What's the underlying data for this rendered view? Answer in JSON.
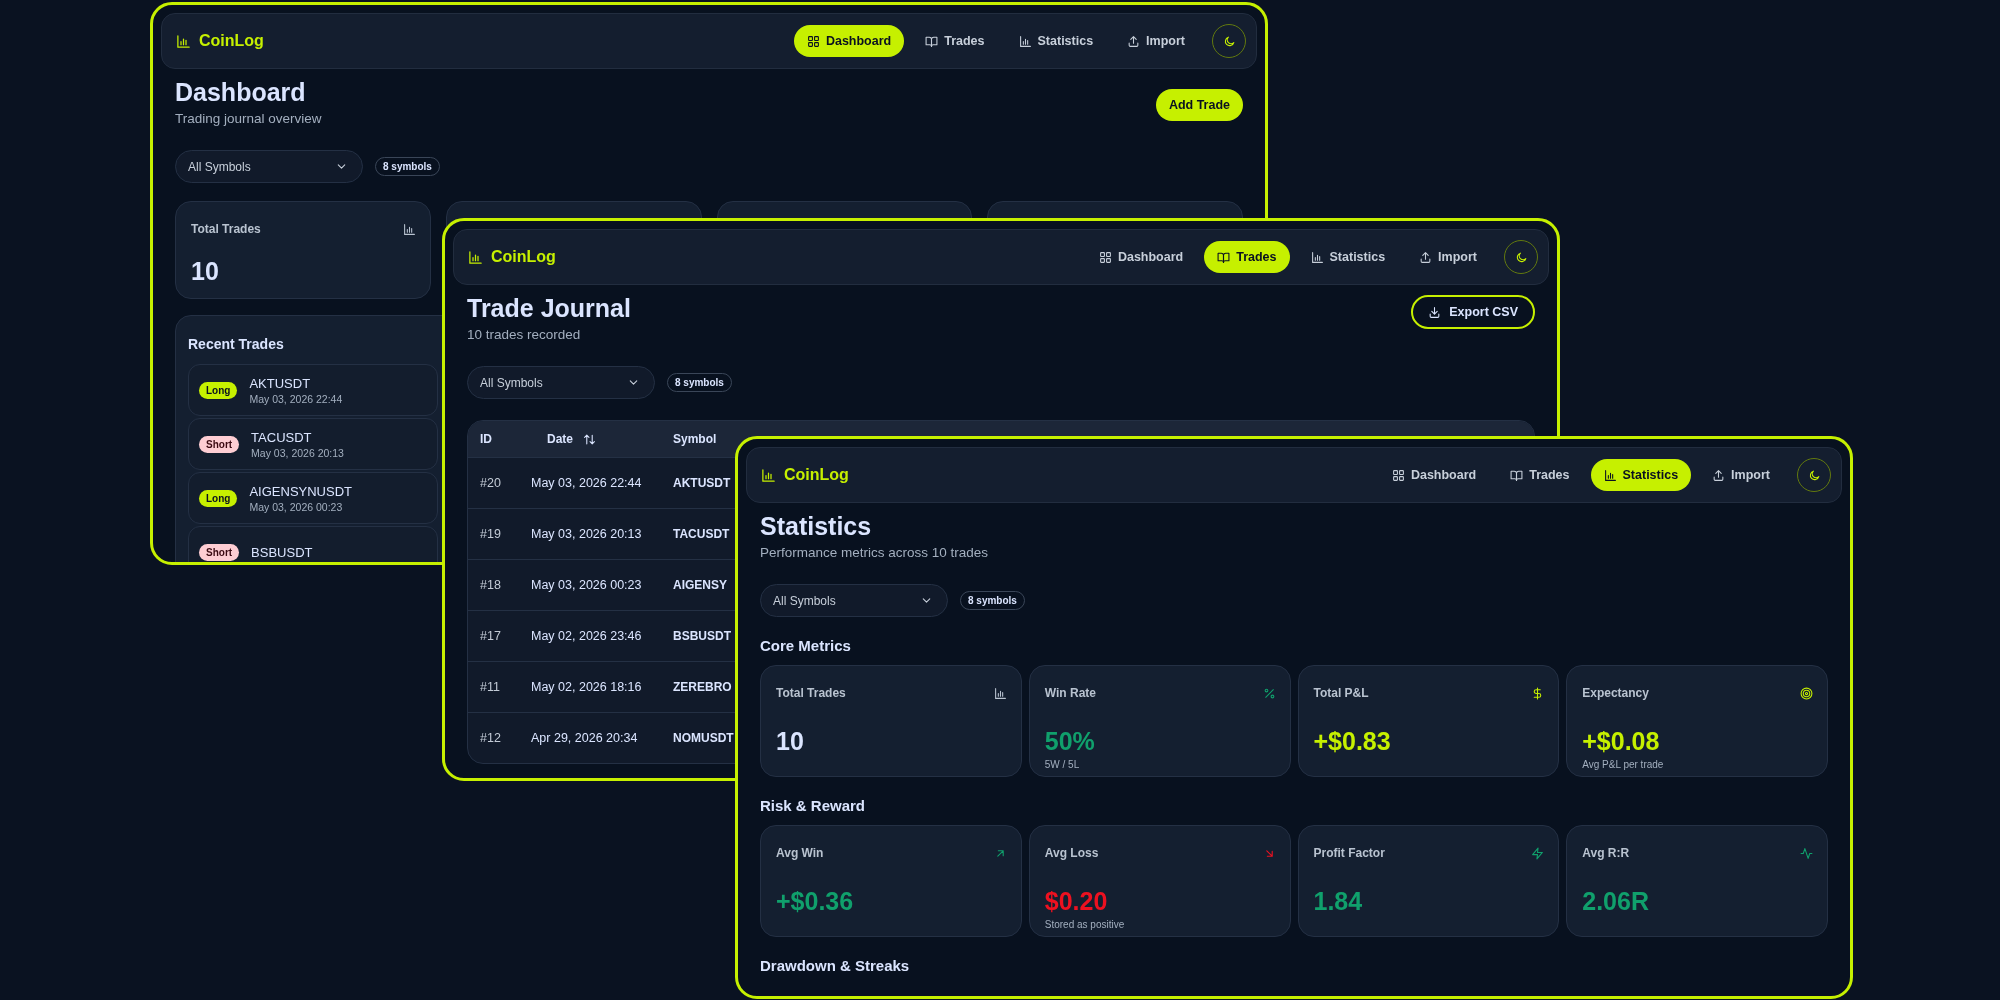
{
  "windows": [
    {
      "kind": "dashboard",
      "app_name": "CoinLog",
      "nav": [
        {
          "label": "Dashboard",
          "selected": true
        },
        {
          "label": "Trades",
          "selected": false
        },
        {
          "label": "Statistics",
          "selected": false
        },
        {
          "label": "Import",
          "selected": false
        }
      ],
      "title": "Dashboard",
      "subtitle": "Trading journal overview",
      "action": {
        "kind": "primary",
        "label": "Add Trade"
      },
      "filter": {
        "value": "All Symbols"
      },
      "symbol_count": "8 symbols",
      "stat_cards": [
        {
          "label": "Total Trades",
          "value": "10",
          "color": "#dbe5ff"
        }
      ],
      "recent_trades": {
        "title": "Recent Trades",
        "rows": [
          {
            "side": "Long",
            "kind": "long",
            "symbol": "AKTUSDT",
            "date": "May 03, 2026 22:44"
          },
          {
            "side": "Short",
            "kind": "short",
            "symbol": "TACUSDT",
            "date": "May 03, 2026 20:13"
          },
          {
            "side": "Long",
            "kind": "long",
            "symbol": "AIGENSYNUSDT",
            "date": "May 03, 2026 00:23"
          },
          {
            "side": "Short",
            "kind": "short",
            "symbol": "BSBUSDT"
          }
        ]
      }
    },
    {
      "kind": "trades",
      "app_name": "CoinLog",
      "nav": [
        {
          "label": "Dashboard",
          "selected": false
        },
        {
          "label": "Trades",
          "selected": true
        },
        {
          "label": "Statistics",
          "selected": false
        },
        {
          "label": "Import",
          "selected": false
        }
      ],
      "title": "Trade Journal",
      "subtitle": "10 trades recorded",
      "action": {
        "kind": "outline",
        "label": "Export CSV"
      },
      "filter": {
        "value": "All Symbols"
      },
      "symbol_count": "8 symbols",
      "table": {
        "columns": [
          "ID",
          "Date",
          "Symbol"
        ],
        "rows": [
          {
            "id": "#20",
            "date": "May 03, 2026 22:44",
            "symbol": "AKTUSDT"
          },
          {
            "id": "#19",
            "date": "May 03, 2026 20:13",
            "symbol": "TACUSDT"
          },
          {
            "id": "#18",
            "date": "May 03, 2026 00:23",
            "symbol": "AIGENSY"
          },
          {
            "id": "#17",
            "date": "May 02, 2026 23:46",
            "symbol": "BSBUSDT"
          },
          {
            "id": "#11",
            "date": "May 02, 2026 18:16",
            "symbol": "ZEREBRO"
          },
          {
            "id": "#12",
            "date": "Apr 29, 2026 20:34",
            "symbol": "NOMUSDT"
          }
        ]
      }
    },
    {
      "kind": "statistics",
      "app_name": "CoinLog",
      "nav": [
        {
          "label": "Dashboard",
          "selected": false
        },
        {
          "label": "Trades",
          "selected": false
        },
        {
          "label": "Statistics",
          "selected": true
        },
        {
          "label": "Import",
          "selected": false
        }
      ],
      "title": "Statistics",
      "subtitle": "Performance metrics across 10 trades",
      "filter": {
        "value": "All Symbols"
      },
      "symbol_count": "8 symbols",
      "sections": [
        {
          "title": "Core Metrics",
          "cards": [
            {
              "label": "Total Trades",
              "value": "10",
              "color": "#dbe5ff"
            },
            {
              "label": "Win Rate",
              "value": "50%",
              "note": "5W / 5L",
              "color": "#10a06c"
            },
            {
              "label": "Total P&L",
              "value": "+$0.83",
              "color": "#c6f000"
            },
            {
              "label": "Expectancy",
              "value": "+$0.08",
              "note": "Avg P&L per trade",
              "color": "#c6f000"
            }
          ]
        },
        {
          "title": "Risk & Reward",
          "cards": [
            {
              "label": "Avg Win",
              "value": "+$0.36",
              "color": "#10a06c"
            },
            {
              "label": "Avg Loss",
              "value": "$0.20",
              "note": "Stored as positive",
              "color": "#ee1120"
            },
            {
              "label": "Profit Factor",
              "value": "1.84",
              "color": "#10a06c"
            },
            {
              "label": "Avg R:R",
              "value": "2.06R",
              "color": "#10a06c"
            }
          ]
        },
        {
          "title": "Drawdown & Streaks"
        }
      ]
    }
  ]
}
